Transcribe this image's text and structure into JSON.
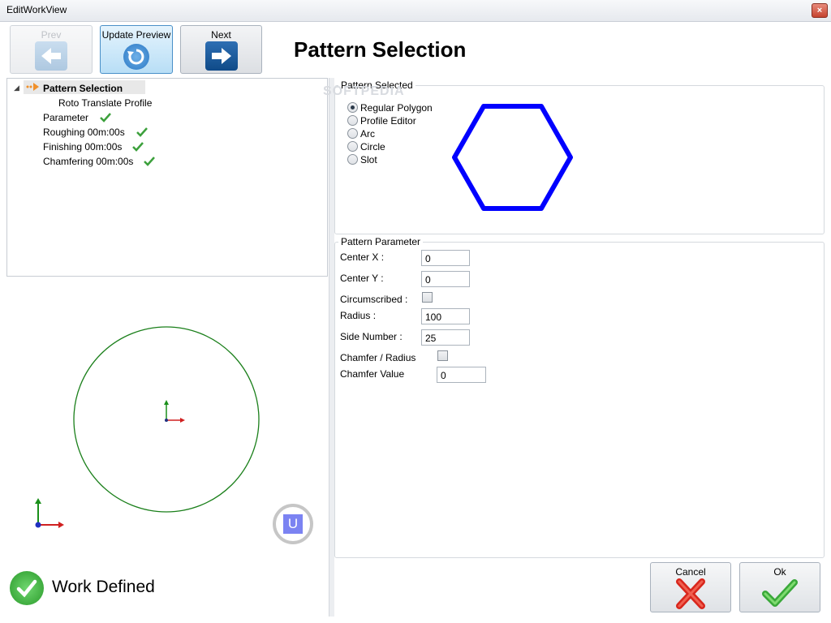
{
  "window": {
    "title": "EditWorkView",
    "close_glyph": "×"
  },
  "toolbar": {
    "prev_label": "Prev",
    "update_label": "Update Preview",
    "next_label": "Next"
  },
  "page_title": "Pattern Selection",
  "tree": {
    "items": [
      {
        "label": "Pattern Selection",
        "checked": false,
        "selected": true
      },
      {
        "label": "Roto Translate Profile",
        "checked": false
      },
      {
        "label": "Parameter",
        "checked": true
      },
      {
        "label": "Roughing 00m:00s",
        "checked": true
      },
      {
        "label": "Finishing 00m:00s",
        "checked": true
      },
      {
        "label": "Chamfering 00m:00s",
        "checked": true
      }
    ]
  },
  "pattern_selected": {
    "title": "Pattern Selected",
    "options": [
      "Regular Polygon",
      "Profile Editor",
      "Arc",
      "Circle",
      "Slot"
    ],
    "selected": "Regular Polygon",
    "preview_color": "#0000ff"
  },
  "pattern_parameter": {
    "title": "Pattern Parameter",
    "center_x": {
      "label": "Center X :",
      "value": "0"
    },
    "center_y": {
      "label": "Center Y :",
      "value": "0"
    },
    "circumscribed": {
      "label": "Circumscribed :",
      "checked": false
    },
    "radius": {
      "label": "Radius :",
      "value": "100"
    },
    "side_number": {
      "label": "Side Number :",
      "value": "25"
    },
    "chamfer_radius": {
      "label": "Chamfer / Radius",
      "checked": false
    },
    "chamfer_value": {
      "label": "Chamfer Value",
      "value": "0"
    }
  },
  "viewport": {
    "shape_color": "#1a7f1a",
    "ucs_label": "U"
  },
  "status": {
    "text": "Work Defined",
    "color": "#3cb43c"
  },
  "actions": {
    "cancel_label": "Cancel",
    "ok_label": "Ok"
  },
  "watermark": "SOFTPEDIA"
}
